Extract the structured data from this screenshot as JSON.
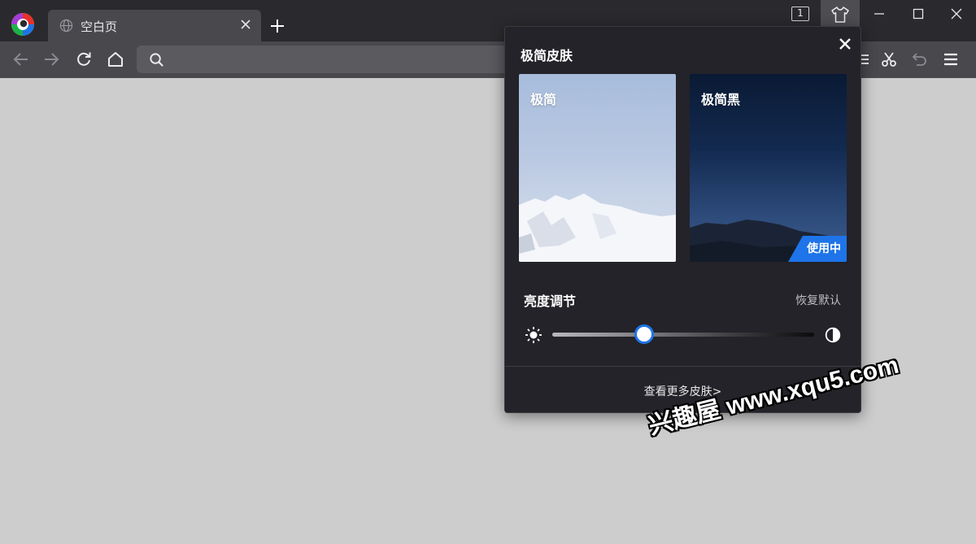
{
  "tab": {
    "title": "空白页"
  },
  "window": {
    "tab_count": "1"
  },
  "skin_panel": {
    "title": "极简皮肤",
    "skins": [
      {
        "label": "极简",
        "active": false
      },
      {
        "label": "极简黑",
        "active": true,
        "badge": "使用中"
      }
    ],
    "brightness": {
      "title": "亮度调节",
      "restore_label": "恢复默认",
      "value": 0.35
    },
    "more_link": "查看更多皮肤>"
  },
  "watermark": {
    "text": "兴趣屋 www.xqu5.com"
  },
  "colors": {
    "accent": "#1e74e8",
    "titlebar": "#2a2a2e",
    "toolbar": "#48484d",
    "panel": "#232329",
    "page": "#cdcdcd"
  },
  "icons": [
    "browser-logo",
    "globe-icon",
    "close-icon",
    "plus-icon",
    "tab-counter",
    "skin-shirt-icon",
    "minimize-icon",
    "maximize-icon",
    "window-close-icon",
    "back-icon",
    "forward-icon",
    "reload-icon",
    "home-icon",
    "search-icon",
    "scissors-icon",
    "undo-icon",
    "menu-icon",
    "sun-icon",
    "contrast-icon"
  ]
}
